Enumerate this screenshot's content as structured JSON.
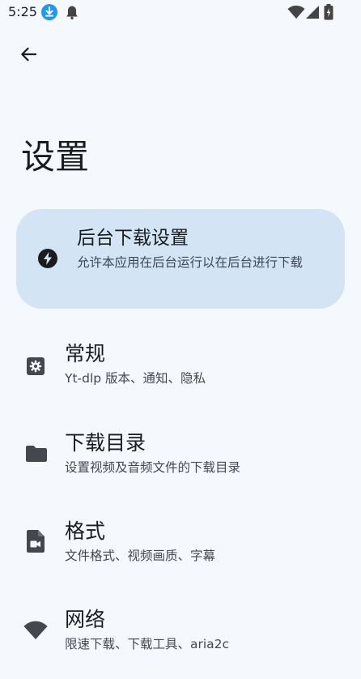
{
  "status_bar": {
    "time": "5:25",
    "icons": [
      "download-badge-icon",
      "notification-bell-icon",
      "wifi-icon",
      "cellular-signal-icon",
      "battery-charging-icon"
    ]
  },
  "header": {
    "back_icon": "arrow-left-icon",
    "title": "设置"
  },
  "featured": {
    "icon": "lightning-bolt-icon",
    "title": "后台下载设置",
    "subtitle": "允许本应用在后台运行以在后台进行下载"
  },
  "items": [
    {
      "icon": "gear-icon",
      "title": "常规",
      "subtitle": "Yt-dlp 版本、通知、隐私"
    },
    {
      "icon": "folder-icon",
      "title": "下载目录",
      "subtitle": "设置视频及音频文件的下载目录"
    },
    {
      "icon": "video-file-icon",
      "title": "格式",
      "subtitle": "文件格式、视频画质、字幕"
    },
    {
      "icon": "wifi-icon",
      "title": "网络",
      "subtitle": "限速下载、下载工具、aria2c"
    }
  ],
  "colors": {
    "background": "#f5f8fd",
    "featured_card": "#d3e4f5",
    "icon": "#44474e",
    "text_primary": "#1a1c1e",
    "text_secondary": "#44474e"
  }
}
